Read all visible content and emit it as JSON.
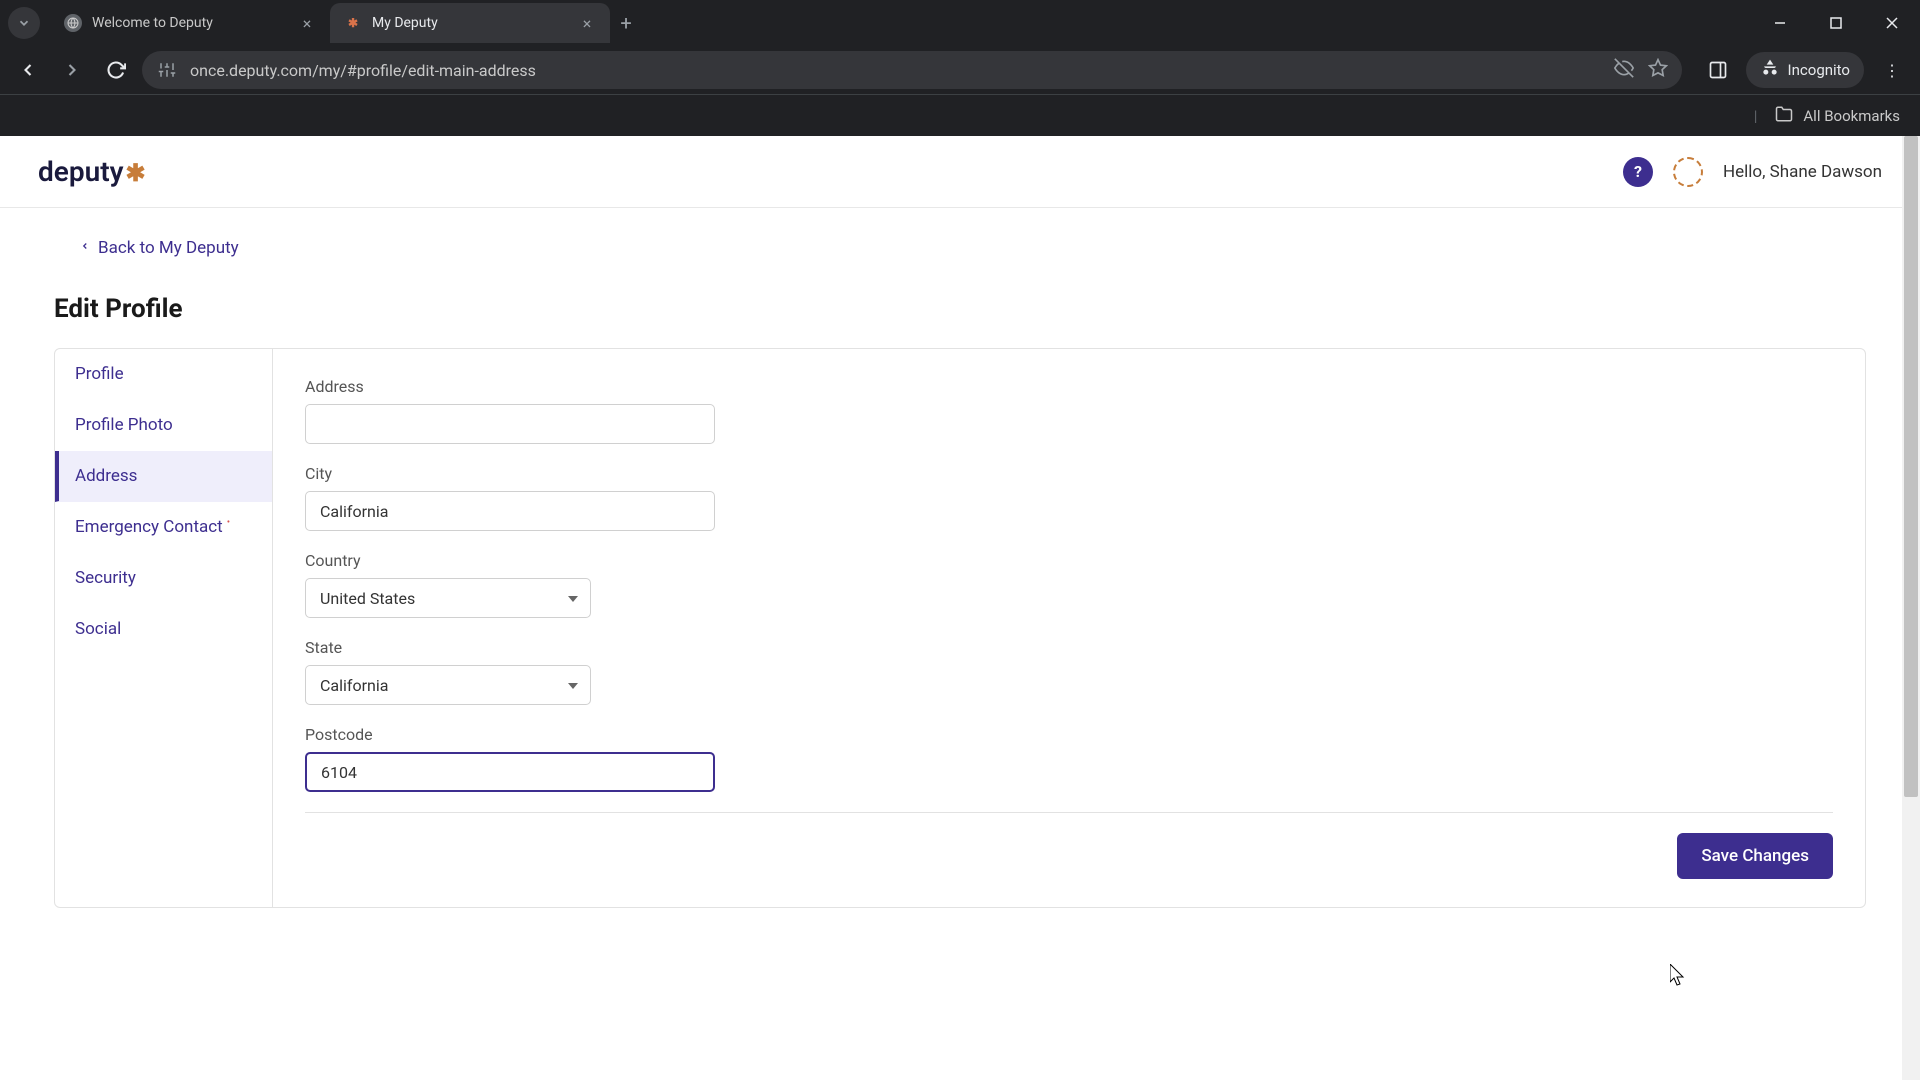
{
  "browser": {
    "tabs": [
      {
        "title": "Welcome to Deputy",
        "active": false
      },
      {
        "title": "My Deputy",
        "active": true
      }
    ],
    "url": "once.deputy.com/my/#profile/edit-main-address",
    "incognito_label": "Incognito",
    "all_bookmarks": "All Bookmarks"
  },
  "header": {
    "logo": "deputy",
    "greeting": "Hello, Shane Dawson"
  },
  "nav": {
    "back_link": "Back to My Deputy",
    "page_title": "Edit Profile"
  },
  "sidebar": {
    "items": [
      {
        "label": "Profile"
      },
      {
        "label": "Profile Photo"
      },
      {
        "label": "Address"
      },
      {
        "label": "Emergency Contact"
      },
      {
        "label": "Security"
      },
      {
        "label": "Social"
      }
    ]
  },
  "form": {
    "address": {
      "label": "Address",
      "value": ""
    },
    "city": {
      "label": "City",
      "value": "California"
    },
    "country": {
      "label": "Country",
      "value": "United States"
    },
    "state": {
      "label": "State",
      "value": "California"
    },
    "postcode": {
      "label": "Postcode",
      "value": "6104"
    },
    "save_label": "Save Changes"
  }
}
